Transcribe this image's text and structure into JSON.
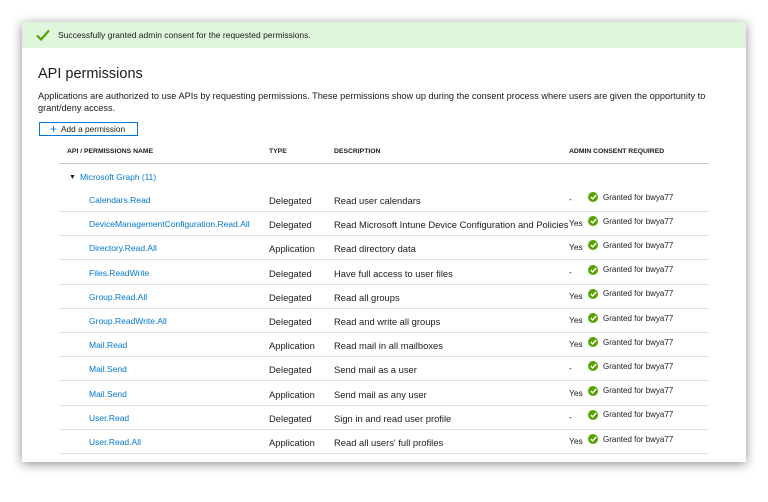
{
  "banner": {
    "message": "Successfully granted admin consent for the requested permissions."
  },
  "page": {
    "title": "API permissions",
    "description": "Applications are authorized to use APIs by requesting permissions. These permissions show up during the consent process where users are given the opportunity to grant/deny access."
  },
  "toolbar": {
    "add_label": "Add a permission"
  },
  "table": {
    "headers": {
      "name": "API / PERMISSIONS NAME",
      "type": "TYPE",
      "description": "DESCRIPTION",
      "consent": "ADMIN CONSENT REQUIRED"
    },
    "group": "Microsoft Graph (11)",
    "rows": [
      {
        "name": "Calendars.Read",
        "type": "Delegated",
        "description": "Read user calendars",
        "consent": "-",
        "status": "Granted for bwya77"
      },
      {
        "name": "DeviceManagementConfiguration.Read.All",
        "type": "Delegated",
        "description": "Read Microsoft Intune Device Configuration and Policies",
        "consent": "Yes",
        "status": "Granted for bwya77"
      },
      {
        "name": "Directory.Read.All",
        "type": "Application",
        "description": "Read directory data",
        "consent": "Yes",
        "status": "Granted for bwya77"
      },
      {
        "name": "Files.ReadWrite",
        "type": "Delegated",
        "description": "Have full access to user files",
        "consent": "-",
        "status": "Granted for bwya77"
      },
      {
        "name": "Group.Read.All",
        "type": "Delegated",
        "description": "Read all groups",
        "consent": "Yes",
        "status": "Granted for bwya77"
      },
      {
        "name": "Group.ReadWrite.All",
        "type": "Delegated",
        "description": "Read and write all groups",
        "consent": "Yes",
        "status": "Granted for bwya77"
      },
      {
        "name": "Mail.Read",
        "type": "Application",
        "description": "Read mail in all mailboxes",
        "consent": "Yes",
        "status": "Granted for bwya77"
      },
      {
        "name": "Mail.Send",
        "type": "Delegated",
        "description": "Send mail as a user",
        "consent": "-",
        "status": "Granted for bwya77"
      },
      {
        "name": "Mail.Send",
        "type": "Application",
        "description": "Send mail as any user",
        "consent": "Yes",
        "status": "Granted for bwya77"
      },
      {
        "name": "User.Read",
        "type": "Delegated",
        "description": "Sign in and read user profile",
        "consent": "-",
        "status": "Granted for bwya77"
      },
      {
        "name": "User.Read.All",
        "type": "Application",
        "description": "Read all users' full profiles",
        "consent": "Yes",
        "status": "Granted for bwya77"
      }
    ]
  },
  "colors": {
    "accent": "#0078d4",
    "success": "#57a300",
    "banner_bg": "#dff6dd"
  },
  "icons": {
    "banner": "checkmark-icon",
    "add": "plus-icon",
    "expand": "triangle-down-icon",
    "granted": "check-circle-icon"
  }
}
